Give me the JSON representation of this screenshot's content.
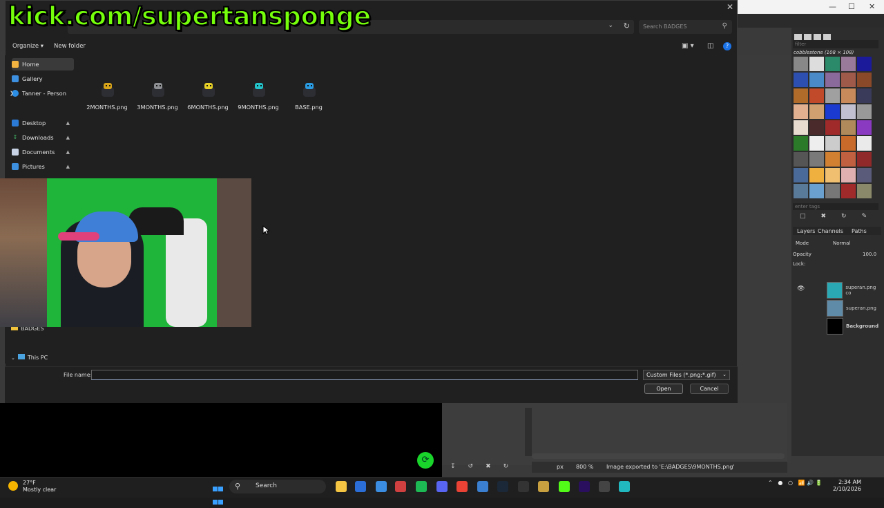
{
  "overlay": {
    "text": "kick.com/supertansponge"
  },
  "dialog": {
    "search_placeholder": "Search BADGES",
    "toolbar": {
      "organize": "Organize",
      "new_folder": "New folder"
    },
    "nav": {
      "home": "Home",
      "gallery": "Gallery",
      "onedrive": "Tanner - Person",
      "desktop": "Desktop",
      "downloads": "Downloads",
      "documents": "Documents",
      "pictures": "Pictures",
      "badges": "BADGES",
      "this_pc": "This PC"
    },
    "files": [
      {
        "name": "2MONTHS.png",
        "color": "#d8a41a"
      },
      {
        "name": "3MONTHS.png",
        "color": "#8d8f92"
      },
      {
        "name": "6MONTHS.png",
        "color": "#e6cf27"
      },
      {
        "name": "9MONTHS.png",
        "color": "#22c2c8"
      },
      {
        "name": "BASE.png",
        "color": "#2a9be0"
      }
    ],
    "file_name_label": "File name:",
    "file_name_value": "",
    "file_type": "Custom Files (*.png;*.gif)",
    "open_label": "Open",
    "cancel_label": "Cancel"
  },
  "gimp": {
    "pattern_name": "cobblestone (108 × 108)",
    "filter_placeholder": "filter",
    "tags_placeholder": "enter tags",
    "tabs": {
      "layers": "Layers",
      "channels": "Channels",
      "paths": "Paths"
    },
    "mode_label": "Mode",
    "mode_value": "Normal",
    "opacity_label": "Opacity",
    "opacity_value": "100.0",
    "lock_label": "Lock:",
    "layers": [
      "superan.png co",
      "superan.png",
      "Background"
    ],
    "status_unit": "px",
    "status_zoom": "800 %",
    "status_message": "Image exported to 'E:\\BADGES\\9MONTHS.png'"
  },
  "taskbar": {
    "temperature": "27°F",
    "weather": "Mostly clear",
    "search": "Search",
    "time": "2:34 AM",
    "date": "2/10/2026"
  },
  "colors": {
    "overlay_text": "#76ff0b",
    "accent": "#1a73e8",
    "dialog_bg": "#202020"
  }
}
